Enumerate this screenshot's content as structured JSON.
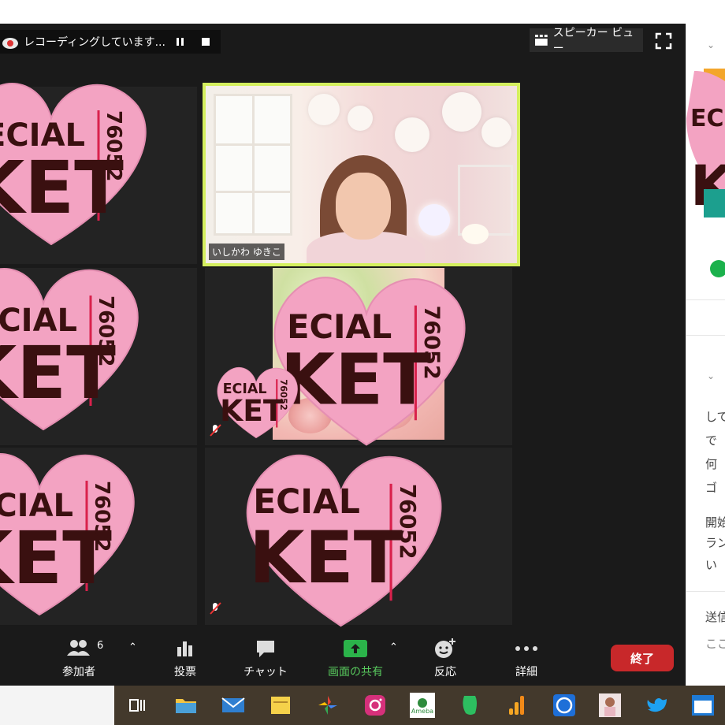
{
  "recording": {
    "label": "レコーディングしています..."
  },
  "view": {
    "speaker_label": "スピーカー ビュー"
  },
  "participants": {
    "active_name": "いしかわ ゆきこ",
    "count": "6"
  },
  "toolbar": {
    "participants_label": "参加者",
    "polls_label": "投票",
    "chat_label": "チャット",
    "share_label": "画面の共有",
    "reactions_label": "反応",
    "more_label": "詳細",
    "end_label": "終了"
  },
  "right_panel": {
    "lines": [
      "して",
      "で",
      "何",
      "ゴ",
      "開始",
      "ラン",
      "い",
      "送信",
      "ここ"
    ]
  },
  "sticker": {
    "text_top": "ECIAL",
    "text_main": "KET",
    "serial": "76052",
    "color": "#f3a3c2"
  },
  "taskbar": {
    "apps": [
      "task-view-icon",
      "file-explorer-icon",
      "mail-icon",
      "sticky-notes-icon",
      "photos-icon",
      "instagram-icon",
      "ameba-icon",
      "evernote-icon",
      "analytics-icon",
      "shazam-icon",
      "profile-photo-icon",
      "twitter-icon",
      "window-icon"
    ],
    "ameba_label": "Ameba"
  }
}
